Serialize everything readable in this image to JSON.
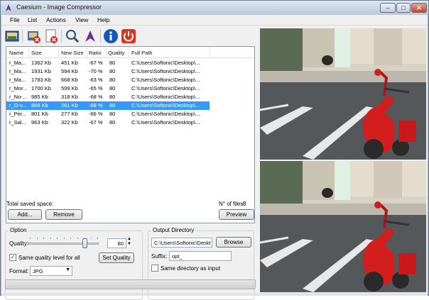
{
  "window": {
    "title": "Caesium - Image Compressor"
  },
  "menu": [
    "File",
    "List",
    "Actions",
    "View",
    "Help"
  ],
  "toolbar": {
    "buttons": [
      {
        "name": "open-icon"
      },
      {
        "name": "remove-item-icon"
      },
      {
        "name": "clear-list-icon"
      },
      {
        "name": "zoom-icon"
      },
      {
        "name": "compress-icon"
      },
      {
        "name": "info-icon"
      },
      {
        "name": "power-icon"
      }
    ]
  },
  "list": {
    "headers": [
      "Name",
      "Size",
      "New Size",
      "Ratio",
      "Quality",
      "Full Path"
    ],
    "rows": [
      {
        "name": "r_Ma...",
        "size": "1362 Kb",
        "new_size": "451 Kb",
        "ratio": "-67 %",
        "quality": "80",
        "path": "C:\\Users\\Softonic\\Desktop\\..."
      },
      {
        "name": "r_Ma...",
        "size": "1931 Kb",
        "new_size": "594 Kb",
        "ratio": "-70 %",
        "quality": "80",
        "path": "C:\\Users\\Softonic\\Desktop\\..."
      },
      {
        "name": "r_Ma...",
        "size": "1783 Kb",
        "new_size": "668 Kb",
        "ratio": "-63 %",
        "quality": "80",
        "path": "C:\\Users\\Softonic\\Desktop\\..."
      },
      {
        "name": "r_Mor...",
        "size": "1700 Kb",
        "new_size": "599 Kb",
        "ratio": "-65 %",
        "quality": "80",
        "path": "C:\\Users\\Softonic\\Desktop\\..."
      },
      {
        "name": "r_No-...",
        "size": "985 Kb",
        "new_size": "318 Kb",
        "ratio": "-68 %",
        "quality": "80",
        "path": "C:\\Users\\Softonic\\Desktop\\..."
      },
      {
        "name": "r_O-v...",
        "size": "868 Kb",
        "new_size": "281 Kb",
        "ratio": "-68 %",
        "quality": "80",
        "path": "C:\\Users\\Softonic\\Desktop\\...",
        "selected": true
      },
      {
        "name": "r_Per...",
        "size": "801 Kb",
        "new_size": "277 Kb",
        "ratio": "-66 %",
        "quality": "80",
        "path": "C:\\Users\\Softonic\\Desktop\\..."
      },
      {
        "name": "r_Sal...",
        "size": "963 Kb",
        "new_size": "322 Kb",
        "ratio": "-67 %",
        "quality": "80",
        "path": "C:\\Users\\Softonic\\Desktop\\..."
      }
    ]
  },
  "summary": {
    "total_label": "Total saved space:",
    "nfiles_label": "N° of files:",
    "nfiles_value": "8"
  },
  "buttons": {
    "add": "Add...",
    "remove": "Remove",
    "preview": "Preview",
    "set_quality": "Set Quality",
    "browse": "Browse"
  },
  "option": {
    "title": "Option",
    "quality_label": "Quality:",
    "quality_value": "80",
    "quality_fraction": 0.8,
    "same_quality_label": "Same quality level for all",
    "same_quality_checked": true,
    "format_label": "Format:",
    "format_value": "JPG"
  },
  "output": {
    "title": "Output Directory",
    "dir_value": "C:\\Users\\Softonic\\Deskt",
    "suffix_label": "Suffix:",
    "suffix_value": "opt_",
    "same_dir_label": "Same directory as input",
    "same_dir_checked": false
  },
  "colors": {
    "selection": "#3399ff",
    "info_blue": "#1556b8",
    "power_red": "#d8341e"
  }
}
